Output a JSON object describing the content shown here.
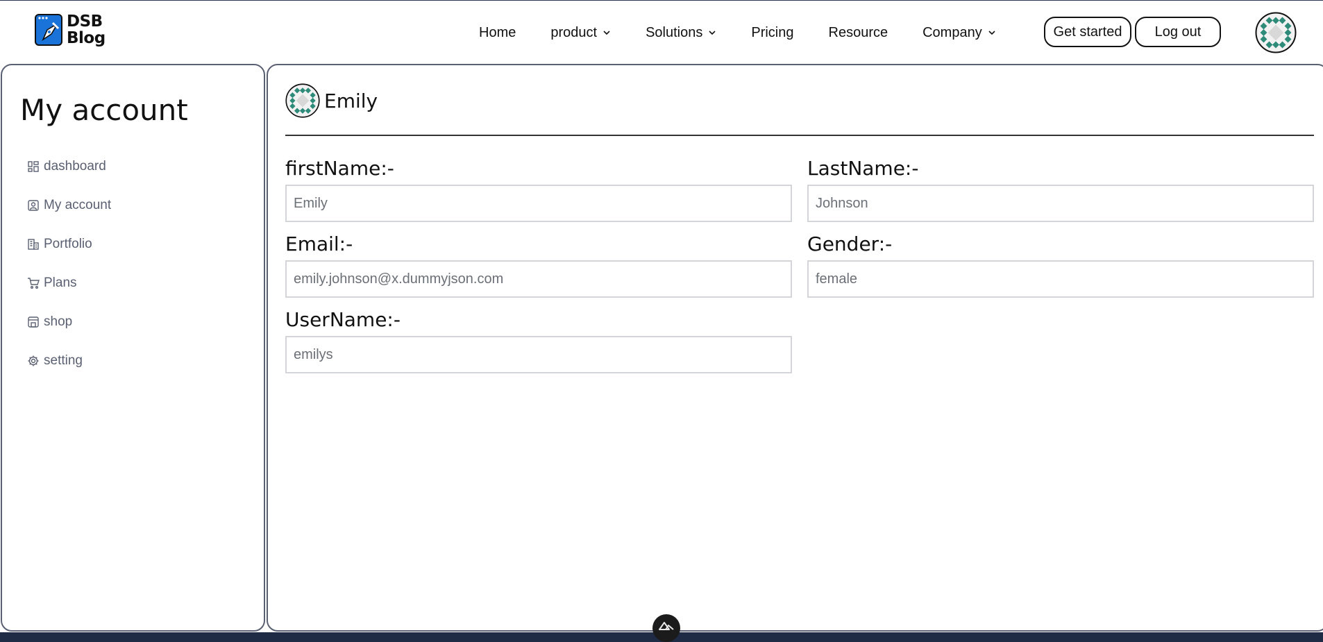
{
  "header": {
    "logo": {
      "line1": "DSB",
      "line2": "Blog"
    },
    "nav": [
      {
        "label": "Home",
        "has_dropdown": false
      },
      {
        "label": "product",
        "has_dropdown": true
      },
      {
        "label": "Solutions",
        "has_dropdown": true
      },
      {
        "label": "Pricing",
        "has_dropdown": false
      },
      {
        "label": "Resource",
        "has_dropdown": false
      },
      {
        "label": "Company",
        "has_dropdown": true
      }
    ],
    "get_started_label": "Get started",
    "logout_label": "Log out",
    "avatar_icon": "geometric-avatar-icon"
  },
  "sidebar": {
    "title": "My account",
    "items": [
      {
        "label": "dashboard",
        "icon": "dashboard-icon"
      },
      {
        "label": "My account",
        "icon": "user-icon"
      },
      {
        "label": "Portfolio",
        "icon": "building-icon"
      },
      {
        "label": "Plans",
        "icon": "cart-icon"
      },
      {
        "label": "shop",
        "icon": "store-icon"
      },
      {
        "label": "setting",
        "icon": "gear-icon"
      }
    ]
  },
  "profile": {
    "display_name": "Emily",
    "fields": {
      "first_name": {
        "label": "firstName:-",
        "placeholder": "Emily"
      },
      "last_name": {
        "label": "LastName:-",
        "placeholder": "Johnson"
      },
      "email": {
        "label": "Email:-",
        "placeholder": "emily.johnson@x.dummyjson.com"
      },
      "gender": {
        "label": "Gender:-",
        "placeholder": "female"
      },
      "username": {
        "label": "UserName:-",
        "placeholder": "emilys"
      }
    }
  },
  "colors": {
    "accent_blue": "#1a73d9",
    "avatar_teal": "#2e8b7a",
    "border_dark": "#5a6072",
    "input_border": "#d3d5d9",
    "bottom_bar": "#1f2a44"
  }
}
